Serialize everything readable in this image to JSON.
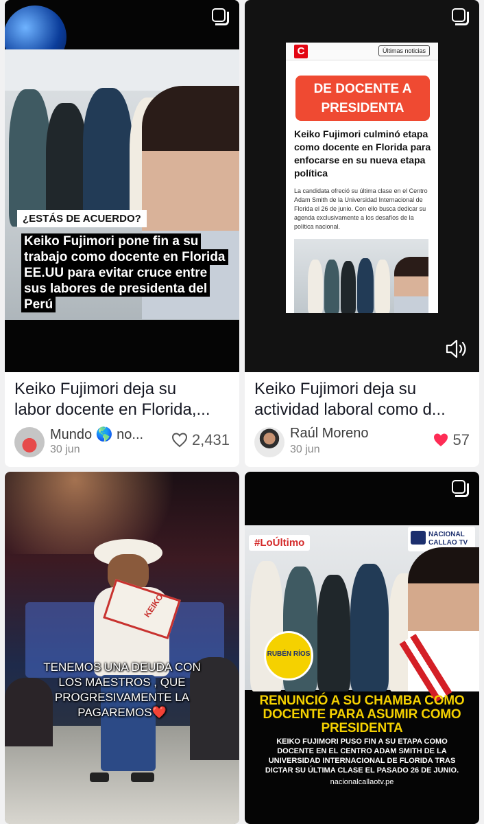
{
  "posts": [
    {
      "overlay_tag": "¿ESTÁS DE ACUERDO?",
      "overlay_headline": "Keiko Fujimori pone fin a su trabajo como docente en Florida EE.UU para evitar cruce entre sus labores de presidenta del Perú",
      "caption_line1": "Keiko Fujimori deja su",
      "caption_line2": "labor docente en Florida,...",
      "author": "Mundo 🌎 no...",
      "date": "30 jun",
      "likes": "2,431",
      "liked": false
    },
    {
      "brand_letter": "C",
      "tag": "Últimas noticias",
      "banner": "DE DOCENTE A PRESIDENTA",
      "article_title": "Keiko Fujimori culminó etapa como docente en Florida para enfocarse en su nueva etapa política",
      "article_body": "La candidata ofreció su última clase en el Centro Adam Smith de la Universidad Internacional de Florida el 26 de junio. Con ello busca dedicar su agenda exclusivamente a los desafíos de la política nacional.",
      "caption_line1": "Keiko Fujimori deja su",
      "caption_line2": "actividad laboral como d...",
      "author": "Raúl Moreno",
      "date": "30 jun",
      "likes": "57",
      "liked": true
    },
    {
      "overlay_text": "TENEMOS UNA DEUDA CON LOS MAESTROS , QUE PROGRESIVAMENTE LA PAGAREMOS❤️",
      "sash_text": "KEIKO"
    },
    {
      "badge": "#LoÚltimo",
      "brand": "NACIONAL CALLAO TV",
      "logo_text": "RUBÉN RÍOS",
      "headline": "RENUNCIÓ A SU CHAMBA COMO DOCENTE PARA ASUMIR COMO PRESIDENTA",
      "subtext": "KEIKO FUJIMORI PUSO FIN A SU ETAPA COMO DOCENTE EN EL CENTRO ADAM SMITH DE LA UNIVERSIDAD INTERNACIONAL DE FLORIDA TRAS DICTAR SU ÚLTIMA CLASE EL PASADO 26 DE JUNIO.",
      "site": "nacionalcallaotv.pe"
    }
  ],
  "colors": {
    "page_bg": "#f1f1f2",
    "like_red": "#fe2c55",
    "ncallao_yellow": "#f5d100",
    "correo_red": "#e30613"
  },
  "icons": {
    "multi_image": "stacked-squares-icon",
    "volume": "speaker-icon",
    "like": "heart-icon"
  }
}
